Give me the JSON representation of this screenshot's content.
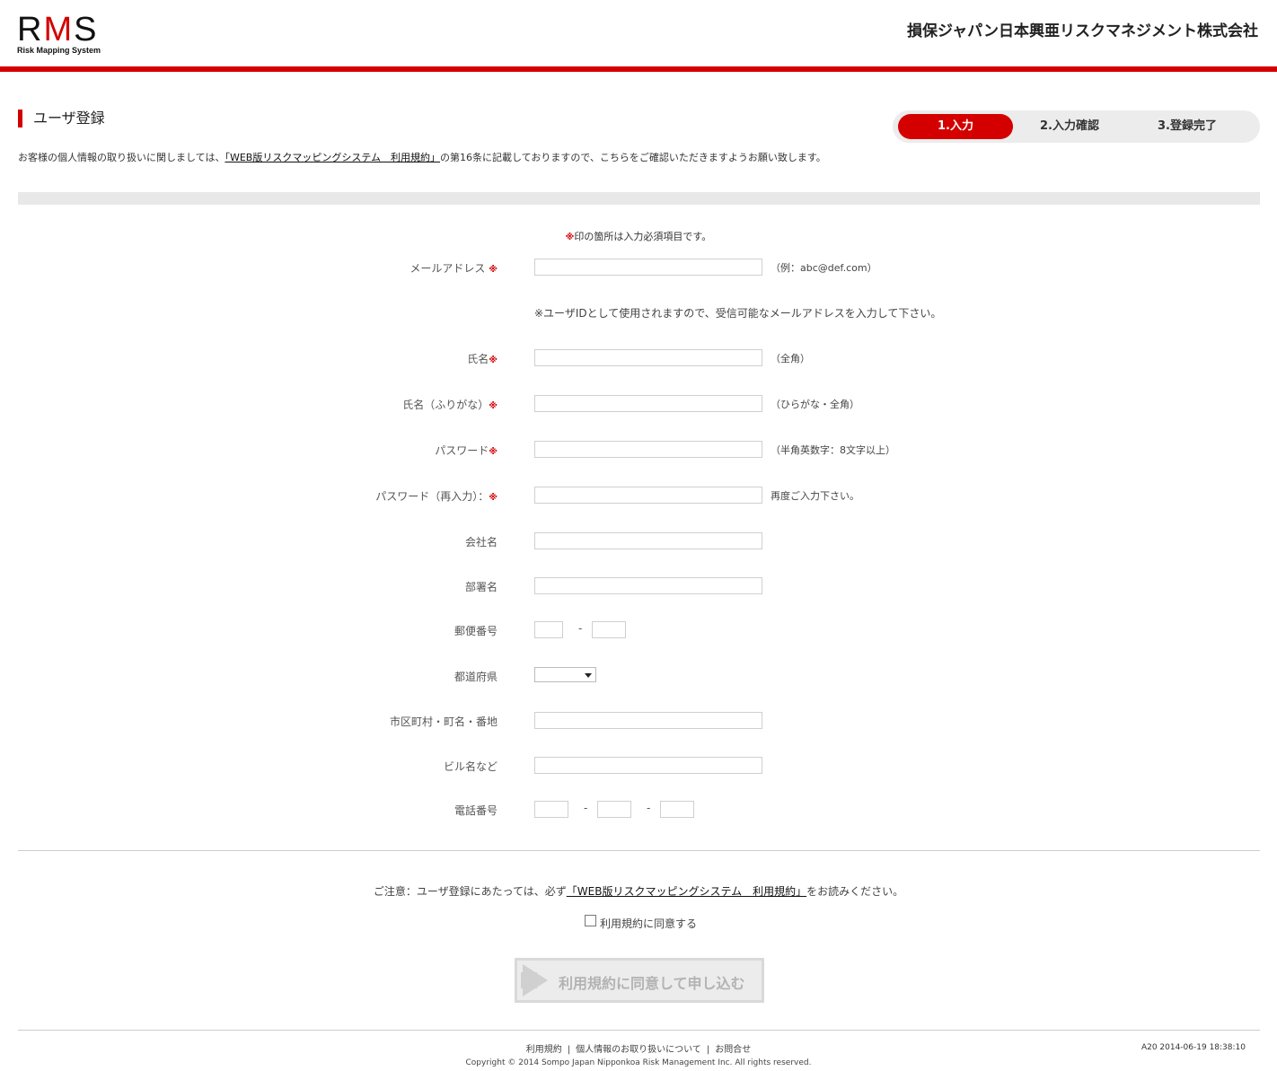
{
  "header": {
    "logo_mark_r": "R",
    "logo_mark_m": "M",
    "logo_mark_s": "S",
    "logo_sub": "Risk Mapping System",
    "company": "損保ジャパン日本興亜リスクマネジメント株式会社"
  },
  "page": {
    "title": "ユーザ登録",
    "notice_before": "お客様の個人情報の取り扱いに関しましては、",
    "notice_link": "「WEB版リスクマッピングシステム　利用規約」",
    "notice_after": "の第16条に記載しておりますので、こちらをご確認いただきますようお願い致します。"
  },
  "steps": [
    {
      "label": "1.入力",
      "active": true
    },
    {
      "label": "2.入力確認",
      "active": false
    },
    {
      "label": "3.登録完了",
      "active": false
    }
  ],
  "form": {
    "required_mark": "※",
    "required_note": "印の箇所は入力必須項目です。",
    "email_label": "メールアドレス",
    "email_hint": "（例：abc@def.com）",
    "email_subhint": "※ユーザIDとして使用されますので、受信可能なメールアドレスを入力して下さい。",
    "name_label": "氏名",
    "name_hint": "（全角）",
    "kana_label": "氏名（ふりがな）",
    "kana_hint": "（ひらがな・全角）",
    "password_label": "パスワード",
    "password_hint": "（半角英数字：8文字以上）",
    "password2_label": "パスワード（再入力）：",
    "password2_hint": "再度ご入力下さい。",
    "company_label": "会社名",
    "dept_label": "部署名",
    "postal_label": "郵便番号",
    "pref_label": "都道府県",
    "city_label": "市区町村・町名・番地",
    "building_label": "ビル名など",
    "phone_label": "電話番号",
    "dash": "-"
  },
  "agreement": {
    "text_before": "ご注意：ユーザ登録にあたっては、必ず",
    "text_link": "「WEB版リスクマッピングシステム　利用規約」",
    "text_after": "をお読みください。",
    "checkbox_label": "利用規約に同意する",
    "submit_label": "利用規約に同意して申し込む"
  },
  "footer": {
    "link_terms": "利用規約",
    "link_privacy": "個人情報のお取り扱いについて",
    "link_contact": "お問合せ",
    "sep": "|",
    "version": "A20  2014-06-19 18:38:10",
    "copyright": "Copyright © 2014 Sompo Japan Nipponkoa Risk Management Inc. All rights reserved."
  }
}
